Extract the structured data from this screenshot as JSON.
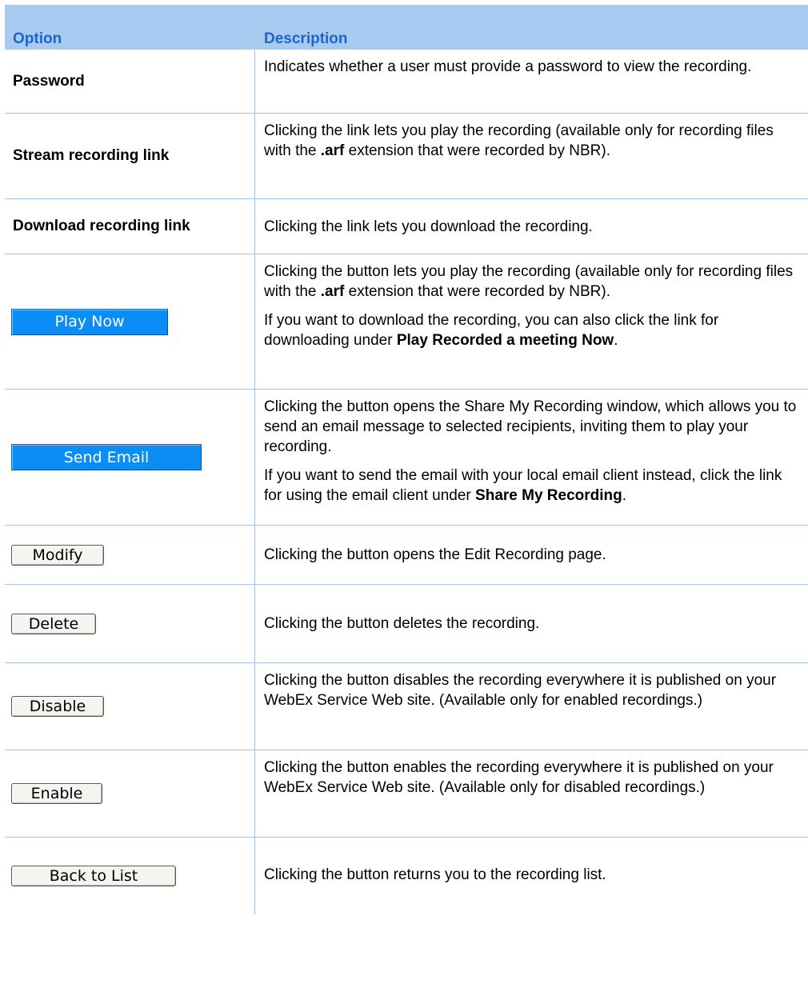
{
  "header": {
    "option": "Option",
    "description": "Description"
  },
  "rows": [
    {
      "option": "Password",
      "d1": [
        {
          "t": "Indicates whether a user must provide a password to view the recording."
        }
      ]
    },
    {
      "option": "Stream recording link",
      "d1": [
        {
          "t": "Clicking the link lets you play the recording (available only for recording files with the "
        },
        {
          "b": ".arf"
        },
        {
          "t": " extension that were recorded by NBR)."
        }
      ]
    },
    {
      "option": "Download recording link",
      "d1": [
        {
          "t": "Clicking the link lets you download the recording."
        }
      ]
    },
    {
      "button": "Play Now",
      "d1": [
        {
          "t": "Clicking the button lets you play the recording (available only for recording files with the "
        },
        {
          "b": ".arf"
        },
        {
          "t": " extension that were recorded by NBR)."
        }
      ],
      "d2": [
        {
          "t": "If you want to download the recording, you can also click the link for downloading under "
        },
        {
          "b": "Play Recorded a meeting Now"
        },
        {
          "t": "."
        }
      ]
    },
    {
      "button": "Send Email",
      "d1": [
        {
          "t": "Clicking the button opens the Share My Recording window, which allows you to send an email message to selected recipients, inviting them to play your recording."
        }
      ],
      "d2": [
        {
          "t": "If you want to send the email with your local email client instead, click the link for using the email client under "
        },
        {
          "b": "Share My Recording"
        },
        {
          "t": "."
        }
      ]
    },
    {
      "button": "Modify",
      "d1": [
        {
          "t": "Clicking the button opens the Edit Recording page."
        }
      ]
    },
    {
      "button": "Delete",
      "d1": [
        {
          "t": "Clicking the button deletes the recording."
        }
      ]
    },
    {
      "button": "Disable",
      "d1": [
        {
          "t": "Clicking the button disables the recording everywhere it is published on your WebEx Service Web site. (Available only for enabled recordings.)"
        }
      ]
    },
    {
      "button": "Enable",
      "d1": [
        {
          "t": "Clicking the button enables the recording everywhere it is published on your WebEx Service Web site. (Available only for disabled recordings.)"
        }
      ]
    },
    {
      "button": "Back to List",
      "d1": [
        {
          "t": "Clicking the button returns you to the recording list."
        }
      ]
    }
  ]
}
